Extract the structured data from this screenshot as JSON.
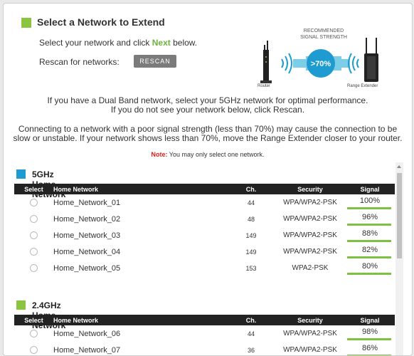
{
  "header": {
    "title": "Select a Network to Extend"
  },
  "instructions": {
    "select_prefix": "Select your network and click ",
    "next_word": "Next",
    "select_suffix": " below.",
    "rescan_label": "Rescan for networks:",
    "rescan_button": "RESCAN"
  },
  "graphic": {
    "recommended_line1": "RECOMMENDED",
    "recommended_line2": "SIGNAL STRENGTH",
    "threshold": ">70%",
    "router_label": "Router",
    "extender_label": "Range Extender"
  },
  "info": {
    "dual_band_1": "If you have a Dual Band network, select your 5GHz network for optimal performance.",
    "dual_band_2": "If you do not see your network below, click Rescan.",
    "poor_signal_1": "Connecting to a network with a poor signal strength (less than 70%) may cause the connection to be",
    "poor_signal_2": "slow or unstable. If your network shows less than 70%, move the Range Extender closer to your router.",
    "note_label": "Note:",
    "note_text": " You may only select one network."
  },
  "table_headers": {
    "select": "Select",
    "network": "Home Network",
    "channel": "Ch.",
    "security": "Security",
    "signal": "Signal"
  },
  "sections": [
    {
      "title": "5GHz Home Network",
      "color": "#1e9bd0",
      "rows": [
        {
          "name": "Home_Network_01",
          "ch": "44",
          "security": "WPA/WPA2-PSK",
          "signal": "100%"
        },
        {
          "name": "Home_Network_02",
          "ch": "48",
          "security": "WPA/WPA2-PSK",
          "signal": "96%"
        },
        {
          "name": "Home_Network_03",
          "ch": "149",
          "security": "WPA/WPA2-PSK",
          "signal": "88%"
        },
        {
          "name": "Home_Network_04",
          "ch": "149",
          "security": "WPA/WPA2-PSK",
          "signal": "82%"
        },
        {
          "name": "Home_Network_05",
          "ch": "153",
          "security": "WPA2-PSK",
          "signal": "80%"
        }
      ]
    },
    {
      "title": "2.4GHz Home Network",
      "color": "#8bc53f",
      "rows": [
        {
          "name": "Home_Network_06",
          "ch": "44",
          "security": "WPA/WPA2-PSK",
          "signal": "98%"
        },
        {
          "name": "Home_Network_07",
          "ch": "36",
          "security": "WPA/WPA2-PSK",
          "signal": "86%"
        }
      ]
    }
  ]
}
